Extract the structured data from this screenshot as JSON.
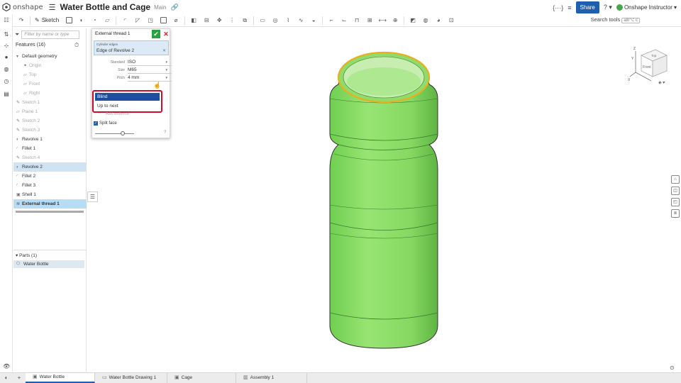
{
  "app": {
    "logo_text": "onshape",
    "document_title": "Water Bottle and Cage",
    "branch": "Main",
    "share_label": "Share",
    "user_name": "Onshape Instructor",
    "help_glyph": "?",
    "brand_color": "#1f5fae",
    "ok_color": "#2aa244"
  },
  "toolbar": {
    "sketch_label": "Sketch",
    "search_tools_label": "Search tools",
    "search_shortcut": "alt/⌥ c"
  },
  "features_panel": {
    "filter_placeholder": "Filter by name or type",
    "features_header": "Features (16)",
    "items": [
      {
        "label": "Default geometry",
        "icon": "chevron-down-icon"
      },
      {
        "label": "Origin",
        "icon": "origin-icon"
      },
      {
        "label": "Top",
        "icon": "plane-icon"
      },
      {
        "label": "Front",
        "icon": "plane-icon"
      },
      {
        "label": "Right",
        "icon": "plane-icon"
      },
      {
        "label": "Sketch 1",
        "icon": "sketch-icon"
      },
      {
        "label": "Plane 1",
        "icon": "plane-icon"
      },
      {
        "label": "Sketch 2",
        "icon": "sketch-icon"
      },
      {
        "label": "Sketch 3",
        "icon": "sketch-icon"
      },
      {
        "label": "Revolve 1",
        "icon": "revolve-icon"
      },
      {
        "label": "Fillet 1",
        "icon": "fillet-icon"
      },
      {
        "label": "Sketch 4",
        "icon": "sketch-icon"
      },
      {
        "label": "Revolve 2",
        "icon": "revolve-icon"
      },
      {
        "label": "Fillet 2",
        "icon": "fillet-icon"
      },
      {
        "label": "Fillet 3",
        "icon": "fillet-icon"
      },
      {
        "label": "Shell 1",
        "icon": "shell-icon"
      },
      {
        "label": "External thread 1",
        "icon": "thread-icon"
      }
    ],
    "parts_header": "Parts (1)",
    "parts": [
      {
        "label": "Water Bottle"
      }
    ]
  },
  "dialog": {
    "title": "External thread 1",
    "selection_label": "Cylinder edges",
    "selection_value": "Edge of Revolve 2",
    "fields": [
      {
        "label": "Standard",
        "value": "ISO"
      },
      {
        "label": "Size",
        "value": "M65"
      },
      {
        "label": "Pitch",
        "value": "4 mm"
      }
    ],
    "end_type_options": [
      "Blind",
      "Up to next"
    ],
    "selected_option": "Blind",
    "undercut_label": "Add undercut",
    "split_face_label": "Split face",
    "split_face_checked": true
  },
  "viewcube": {
    "top_label": "Top",
    "front_label": "Front",
    "axis_x": "X",
    "axis_y": "Y",
    "axis_z": "Z"
  },
  "model": {
    "body_color": "#8fdc6a",
    "highlight_color": "#e8b020"
  },
  "tabs": [
    {
      "label": "Water Bottle",
      "active": true
    },
    {
      "label": "Water Bottle Drawing 1",
      "active": false
    },
    {
      "label": "Cage",
      "active": false
    },
    {
      "label": "Assembly 1",
      "active": false
    }
  ]
}
